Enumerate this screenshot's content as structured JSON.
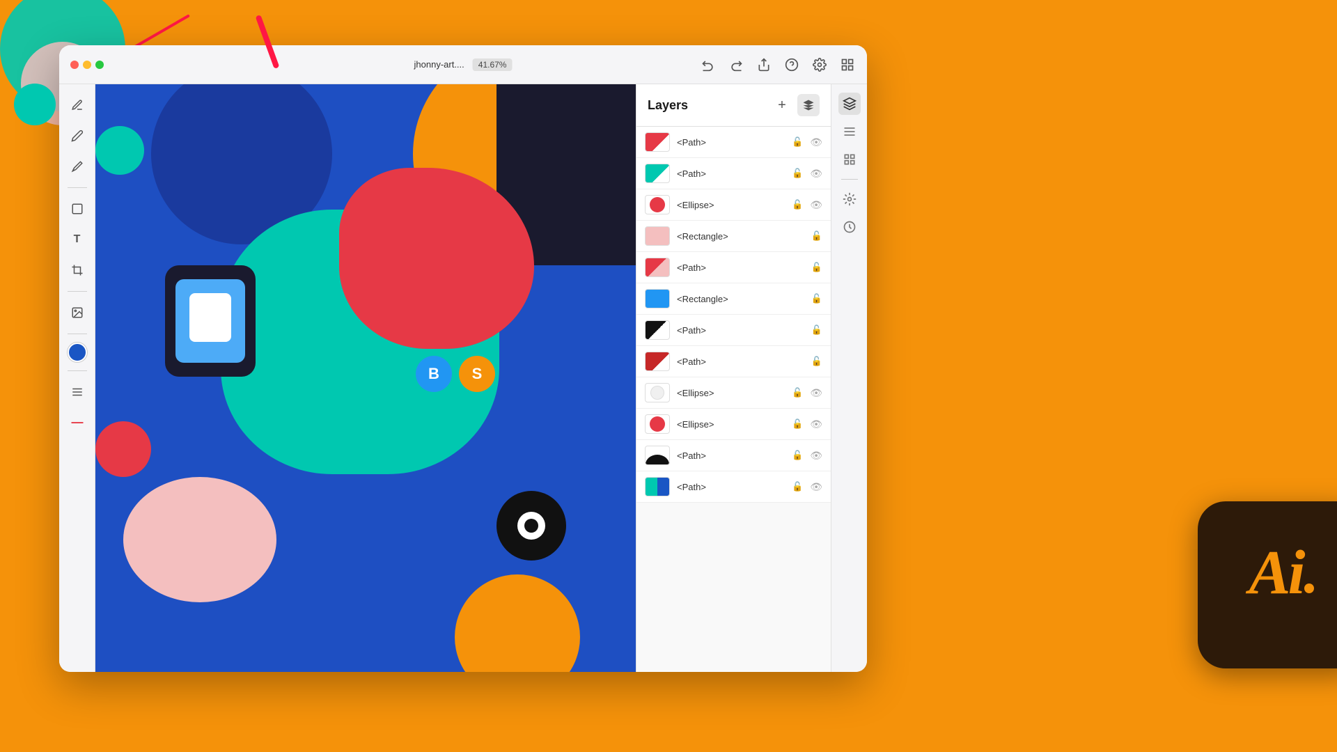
{
  "background_color": "#F5920A",
  "app_window": {
    "title_bar": {
      "file_name": "jhonny-art....",
      "zoom": "41.67%",
      "actions": {
        "undo_label": "↩",
        "redo_label": "↪",
        "share_label": "⬆",
        "help_label": "?",
        "settings_label": "⚙",
        "personas_label": "⊞"
      }
    },
    "toolbar": {
      "tools": [
        {
          "name": "pen-tool",
          "icon": "✒",
          "label": "Pen"
        },
        {
          "name": "pencil-tool",
          "icon": "✏",
          "label": "Pencil"
        },
        {
          "name": "brush-tool",
          "icon": "🖌",
          "label": "Brush"
        },
        {
          "name": "rectangle-tool",
          "icon": "▭",
          "label": "Rectangle"
        },
        {
          "name": "type-tool",
          "icon": "T",
          "label": "Type"
        },
        {
          "name": "crop-tool",
          "icon": "⊹",
          "label": "Crop"
        },
        {
          "name": "image-tool",
          "icon": "⬜",
          "label": "Image"
        },
        {
          "name": "color-swatch",
          "icon": "●",
          "label": "Color"
        },
        {
          "name": "align-tool",
          "icon": "≡",
          "label": "Align"
        },
        {
          "name": "brush2-tool",
          "icon": "⁄",
          "label": "Stroke"
        }
      ],
      "active_color": "#1a56c4"
    }
  },
  "layers_panel": {
    "title": "Layers",
    "add_button_label": "+",
    "items": [
      {
        "name": "<Path>",
        "color": "#E63946",
        "shape": "path",
        "has_lock": true,
        "has_eye": true
      },
      {
        "name": "<Path>",
        "color": "#00C8B0",
        "shape": "path",
        "has_lock": true,
        "has_eye": true
      },
      {
        "name": "<Ellipse>",
        "color": "#E63946",
        "shape": "ellipse",
        "has_lock": true,
        "has_eye": true
      },
      {
        "name": "<Rectangle>",
        "color": "#F4BFBF",
        "shape": "rect",
        "has_lock": true,
        "has_eye": false
      },
      {
        "name": "<Path>",
        "color": "#E63946",
        "shape": "path",
        "has_lock": true,
        "has_eye": false
      },
      {
        "name": "<Rectangle>",
        "color": "#2196F3",
        "shape": "rect",
        "has_lock": true,
        "has_eye": false
      },
      {
        "name": "<Path>",
        "color": "#111111",
        "shape": "path",
        "has_lock": true,
        "has_eye": false
      },
      {
        "name": "<Path>",
        "color": "#C62828",
        "shape": "path",
        "has_lock": true,
        "has_eye": false
      },
      {
        "name": "<Ellipse>",
        "color": "#ffffff",
        "shape": "ellipse",
        "has_lock": true,
        "has_eye": true
      },
      {
        "name": "<Ellipse>",
        "color": "#E63946",
        "shape": "ellipse",
        "has_lock": true,
        "has_eye": true
      },
      {
        "name": "<Path>",
        "color": "#111111",
        "shape": "path",
        "has_lock": true,
        "has_eye": true
      },
      {
        "name": "<Path>",
        "color": "#00C8B0",
        "shape": "path",
        "has_lock": true,
        "has_eye": true
      }
    ]
  },
  "ai_badge": {
    "letter_a": "A",
    "letter_i": "i",
    "bg_color": "#2D1A09",
    "text_color": "#F5920A"
  },
  "right_panel_icons": [
    {
      "name": "layers-icon",
      "icon": "⊞",
      "active": true
    },
    {
      "name": "properties-icon",
      "icon": "≡",
      "active": false
    },
    {
      "name": "library-icon",
      "icon": "📚",
      "active": false
    },
    {
      "name": "effects-icon",
      "icon": "✦",
      "active": false
    }
  ]
}
